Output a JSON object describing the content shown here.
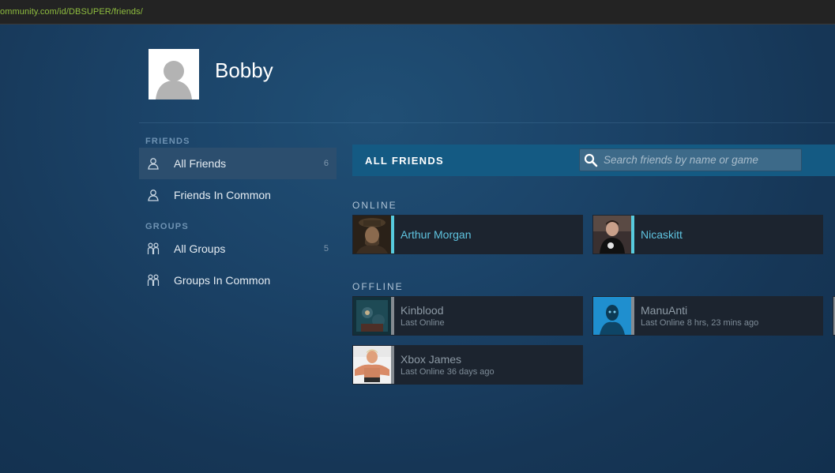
{
  "browser": {
    "url": "ommunity.com/id/DBSUPER/friends/"
  },
  "profile": {
    "name": "Bobby"
  },
  "sidebar": {
    "friends_heading": "FRIENDS",
    "groups_heading": "GROUPS",
    "items": [
      {
        "label": "All Friends",
        "count": "6",
        "icon": "person-icon"
      },
      {
        "label": "Friends In Common",
        "count": "",
        "icon": "person-icon"
      },
      {
        "label": "All Groups",
        "count": "5",
        "icon": "group-icon"
      },
      {
        "label": "Groups In Common",
        "count": "",
        "icon": "group-icon"
      }
    ]
  },
  "content": {
    "title": "ALL FRIENDS",
    "search_placeholder": "Search friends by name or game"
  },
  "online": {
    "label": "ONLINE",
    "friends": [
      {
        "name": "Arthur Morgan",
        "status": ""
      },
      {
        "name": "Nicaskitt",
        "status": ""
      }
    ]
  },
  "offline": {
    "label": "OFFLINE",
    "friends": [
      {
        "name": "Kinblood",
        "status": "Last Online"
      },
      {
        "name": "ManuAnti",
        "status": "Last Online 8 hrs, 23 mins ago"
      },
      {
        "name": "Xbox James",
        "status": "Last Online 36 days ago"
      }
    ]
  },
  "colors": {
    "online_accent": "#57cbde",
    "offline_accent": "#858b91",
    "header_bar": "#145a83"
  }
}
